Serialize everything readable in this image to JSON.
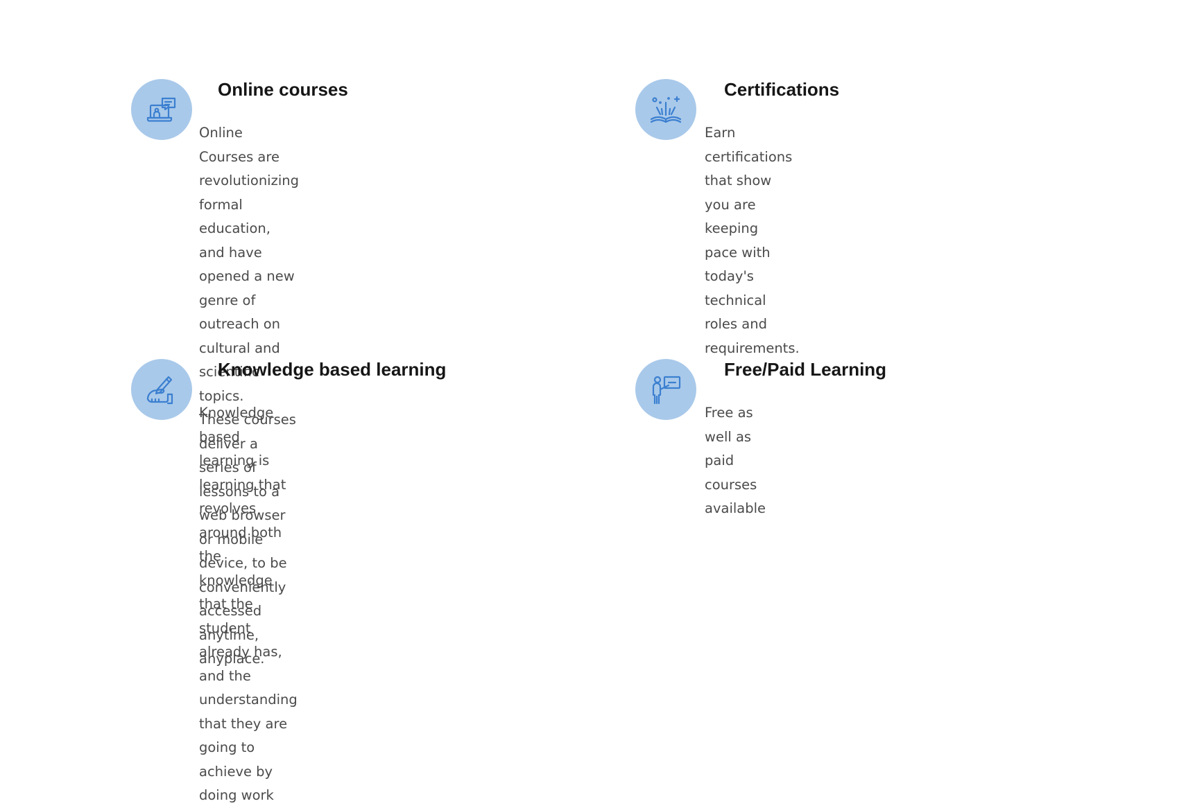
{
  "features": [
    {
      "icon": "online-course-laptop-icon",
      "title": "Online courses",
      "description": "Online Courses are revolutionizing formal\neducation, and have opened a new genre of\noutreach on cultural and scientific topics.\nThese courses deliver a series of lessons to a\nweb browser or mobile device, to be\nconveniently accessed anytime, anyplace."
    },
    {
      "icon": "certification-book-icon",
      "title": "Certifications",
      "description": " Earn certifications that show you are keeping\npace with today's technical roles and\nrequirements."
    },
    {
      "icon": "hand-writing-icon",
      "title": "Knowledge based learning",
      "description": "Knowledge based learning is learning that\nrevolves around both the knowledge that the\nstudent already has, and the understanding\nthat they are going to achieve by doing work"
    },
    {
      "icon": "teacher-board-icon",
      "title": "Free/Paid Learning",
      "description": "Free as well as paid courses available"
    }
  ],
  "colors": {
    "icon_circle": "#a9c9ea",
    "icon_stroke": "#3b7fd0",
    "title": "#161616",
    "text": "#4a4a4a"
  }
}
